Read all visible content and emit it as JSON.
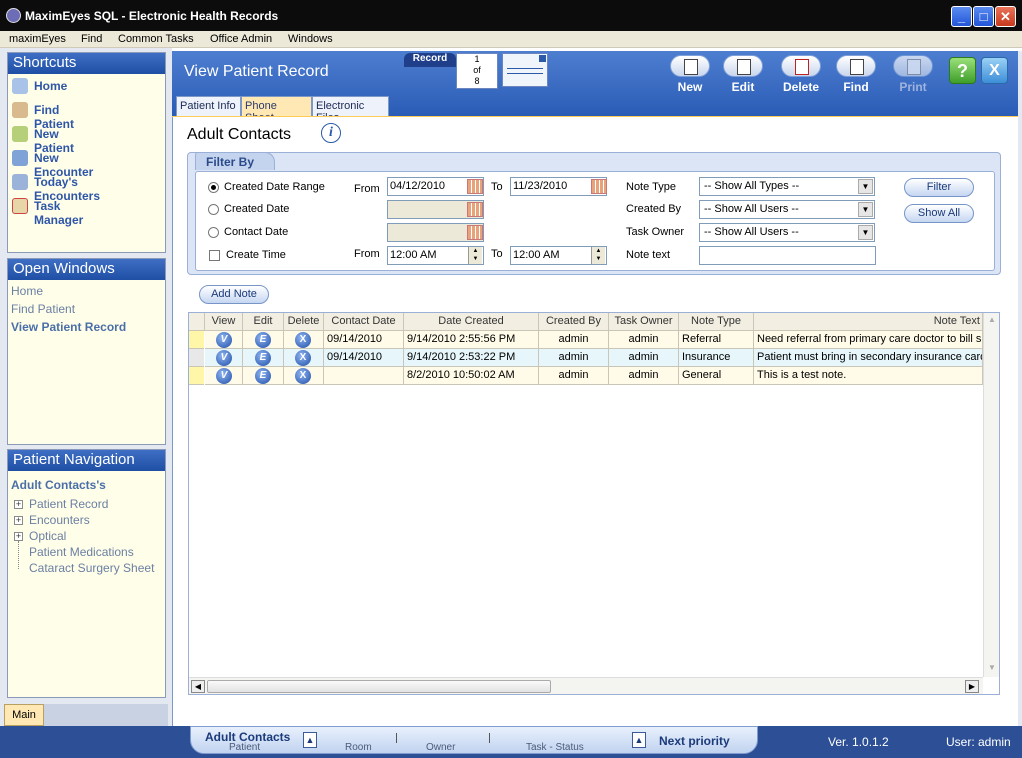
{
  "titlebar": {
    "title": "MaximEyes SQL - Electronic Health Records",
    "minimize": "_",
    "maximize": "□",
    "close": "✕"
  },
  "menu": [
    "maximEyes",
    "Find",
    "Common Tasks",
    "Office Admin",
    "Windows"
  ],
  "shortcuts": {
    "title": "Shortcuts",
    "items": [
      {
        "label": "Home",
        "icon": "home-icon"
      },
      {
        "label": "Find Patient",
        "icon": "find-patient-icon"
      },
      {
        "label": "New Patient",
        "icon": "new-patient-icon"
      },
      {
        "label": "New Encounter",
        "icon": "new-encounter-icon"
      },
      {
        "label": "Today's Encounters",
        "icon": "todays-encounters-icon"
      },
      {
        "label": "Task Manager",
        "icon": "task-manager-icon"
      }
    ]
  },
  "open_windows": {
    "title": "Open Windows",
    "items": [
      "Home",
      "Find Patient",
      "View Patient Record"
    ]
  },
  "patient_nav": {
    "title": "Patient Navigation",
    "patient": "Adult Contacts's",
    "expandable": [
      "Patient Record",
      "Encounters",
      "Optical"
    ],
    "leaves": [
      "Patient Medications",
      "Cataract Surgery Sheet"
    ]
  },
  "main_tab": "Main",
  "header": {
    "title": "View Patient Record",
    "record_label": "Record",
    "record_current": "1",
    "record_of": "of",
    "record_total": "8",
    "tabs": [
      "Patient Info",
      "Phone Sheet",
      "Electronic Files"
    ],
    "actions": {
      "new": "New",
      "edit": "Edit",
      "delete": "Delete",
      "find": "Find",
      "print": "Print"
    },
    "help": "?",
    "close": "X"
  },
  "page": {
    "title": "Adult Contacts",
    "info": "i"
  },
  "filter": {
    "tab": "Filter By",
    "created_date_range": "Created Date Range",
    "created_date": "Created Date",
    "contact_date": "Contact Date",
    "create_time": "Create Time",
    "from": "From",
    "to": "To",
    "from_date": "04/12/2010",
    "to_date": "11/23/2010",
    "from_time": "12:00 AM",
    "to_time": "12:00 AM",
    "note_type_label": "Note Type",
    "created_by_label": "Created By",
    "task_owner_label": "Task Owner",
    "note_text_label": "Note text",
    "note_type_value": "-- Show All Types --",
    "created_by_value": "-- Show All Users --",
    "task_owner_value": "-- Show All Users --",
    "filter_btn": "Filter",
    "show_all_btn": "Show All"
  },
  "add_note": "Add Note",
  "grid": {
    "headers": [
      "View",
      "Edit",
      "Delete",
      "Contact Date",
      "Date Created",
      "Created By",
      "Task Owner",
      "Note Type",
      "Note Text"
    ],
    "btn_view": "V",
    "btn_edit": "E",
    "btn_delete": "X",
    "rows": [
      {
        "contact_date": "09/14/2010",
        "date_created": "9/14/2010 2:55:56 PM",
        "created_by": "admin",
        "task_owner": "admin",
        "note_type": "Referral",
        "note_text": "Need referral from primary care doctor to bill s"
      },
      {
        "contact_date": "09/14/2010",
        "date_created": "9/14/2010 2:53:22 PM",
        "created_by": "admin",
        "task_owner": "admin",
        "note_type": "Insurance",
        "note_text": "Patient must bring in secondary insurance card"
      },
      {
        "contact_date": "",
        "date_created": "8/2/2010 10:50:02 AM",
        "created_by": "admin",
        "task_owner": "admin",
        "note_type": "General",
        "note_text": "This is a test note."
      }
    ]
  },
  "statusbar": {
    "patient_name": "Adult Contacts",
    "patient": "Patient",
    "room": "Room",
    "owner": "Owner",
    "task_status": "Task - Status",
    "next_priority": "Next priority",
    "version": "Ver. 1.0.1.2",
    "user": "User: admin"
  },
  "colors": {
    "header_blue": "#2b5cb6",
    "panel_bg": "#fffee9",
    "active_tab": "#ffe8b4",
    "link": "#2e56a8"
  }
}
